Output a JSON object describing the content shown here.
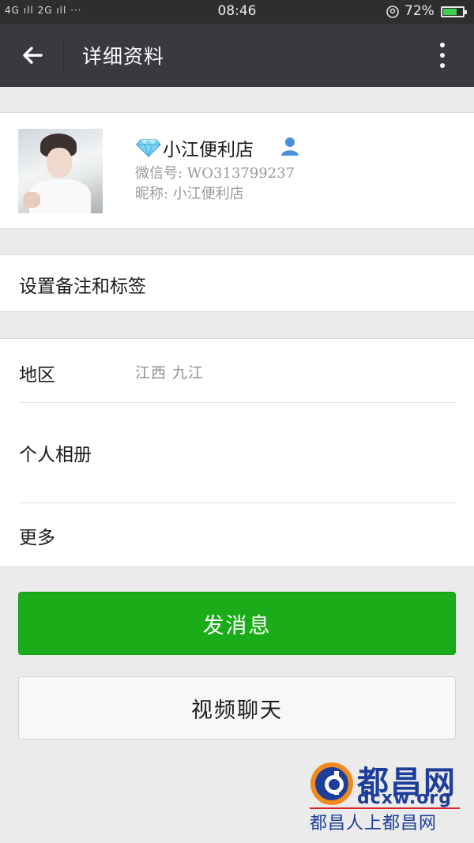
{
  "status_bar": {
    "network": "4G ıll 2G ıll ···",
    "time": "08:46",
    "battery_percent": "72%",
    "battery_level": 0.72,
    "icons": [
      "signal-icon",
      "location-icon",
      "battery-charging-icon"
    ]
  },
  "toolbar": {
    "back_icon": "arrow-left-icon",
    "title": "详细资料",
    "more_icon": "more-vertical-icon"
  },
  "profile": {
    "name": "小江便利店",
    "wechat_id": "微信号: WO313799237",
    "nickname": "昵称: 小江便利店",
    "badge_icon": "diamond-icon",
    "contact_icon": "person-icon"
  },
  "remark": {
    "label": "设置备注和标签"
  },
  "info": {
    "region_label": "地区",
    "region_value": "江西  九江",
    "album_label": "个人相册",
    "more_label": "更多"
  },
  "actions": {
    "send_message": "发消息",
    "video_chat": "视频聊天"
  },
  "watermark": {
    "name": "都昌网",
    "domain": "dcxw.org",
    "slogan": "都昌人上都昌网"
  },
  "colors": {
    "toolbar": "#393a3f",
    "status_bar": "#2e2e2e",
    "primary_green": "#1aad19",
    "background": "#ebebeb",
    "watermark_blue": "#1d3f9a"
  }
}
